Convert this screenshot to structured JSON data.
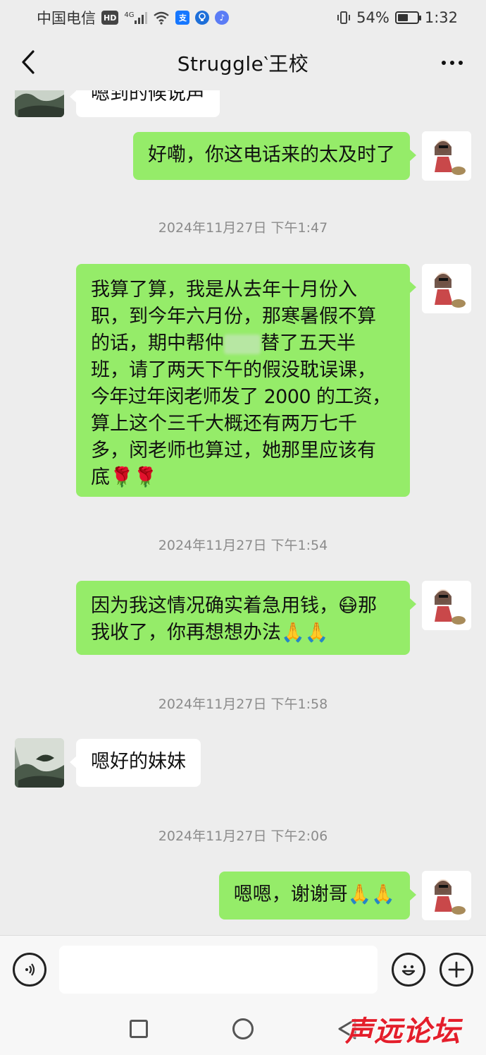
{
  "status_bar": {
    "carrier": "中国电信",
    "hd_badge": "HD",
    "network": "4G",
    "alipay_badge": "支",
    "battery_pct": "54%",
    "battery_level": 0.54,
    "time": "1:32",
    "icons": [
      "hd-icon",
      "signal-icon",
      "wifi-icon",
      "alipay-icon",
      "bulb-icon",
      "music-icon",
      "vibrate-icon",
      "battery-icon"
    ]
  },
  "header": {
    "title": "Struggle‵王校",
    "back_icon": "chevron-left-icon",
    "more_icon": "more-dots-icon"
  },
  "messages": {
    "m0": {
      "side": "other",
      "text": "嗯到的候说声"
    },
    "m1": {
      "side": "mine",
      "text": "好嘞，你这电话来的太及时了"
    },
    "t1": "2024年11月27日 下午1:47",
    "m2": {
      "side": "mine",
      "line1": "我算了算，我是从去年十月份入",
      "line2": "职，到今年六月份，那寒暑假不算",
      "line3a": "的话，期中帮仲",
      "line3b": "替了五天半",
      "line4": "班，请了两天下午的假没耽误课，",
      "line5": "今年过年闵老师发了 2000 的工资，",
      "line6": "算上这个三千大概还有两万七千",
      "line7": "多，闵老师也算过，她那里应该有",
      "line8": "底🌹🌹"
    },
    "t2": "2024年11月27日 下午1:54",
    "m3": {
      "side": "mine",
      "line1": "因为我这情况确实着急用钱，😷那",
      "line2": "我收了，你再想想办法🙏🙏"
    },
    "t3": "2024年11月27日 下午1:58",
    "m4": {
      "side": "other",
      "text": "嗯好的妹妹"
    },
    "t4": "2024年11月27日 下午2:06",
    "m5": {
      "side": "mine",
      "text": "嗯嗯，谢谢哥🙏🙏"
    }
  },
  "input_bar": {
    "placeholder": "",
    "icons": [
      "voice-icon",
      "emoji-icon",
      "plus-icon"
    ]
  },
  "watermark": {
    "text": "声远论坛"
  },
  "colors": {
    "bubble_mine": "#95ec69",
    "bubble_other": "#ffffff",
    "background": "#ededed"
  }
}
